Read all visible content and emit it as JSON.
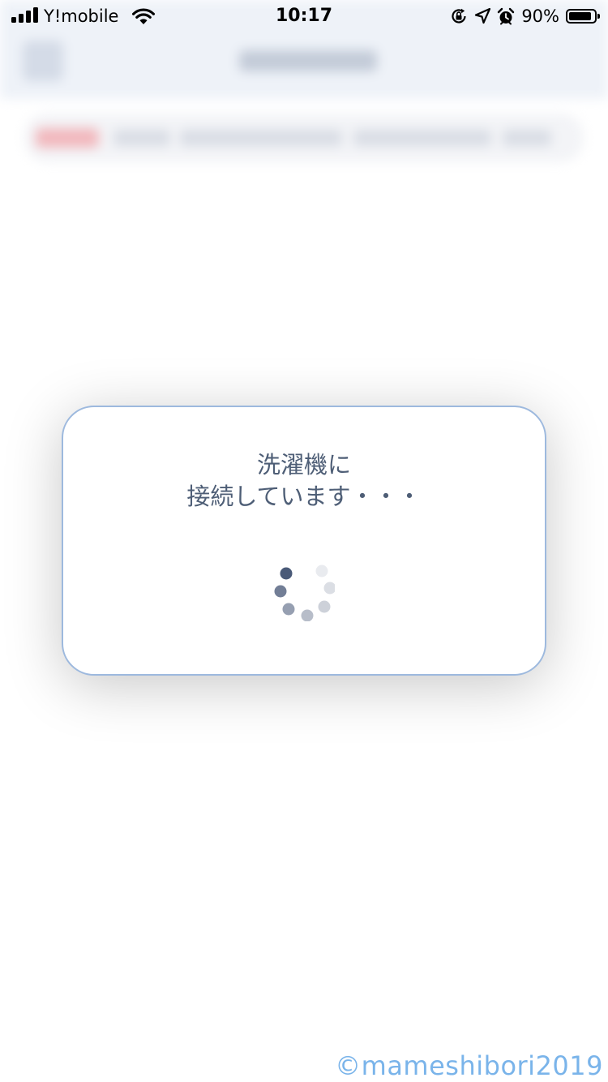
{
  "status_bar": {
    "carrier": "Y!mobile",
    "time": "10:17",
    "battery_percent": "90%",
    "battery_level": 0.9,
    "icons": [
      "cellular-signal-icon",
      "wifi-icon",
      "orientation-lock-icon",
      "location-arrow-icon",
      "alarm-clock-icon",
      "battery-icon"
    ]
  },
  "dialog": {
    "line1": "洗濯機に",
    "line2": "接続しています・・・",
    "text_color": "#4e5e76",
    "border_color": "#9db9de"
  },
  "spinner": {
    "icon": "loading-spinner-icon",
    "dot_color": "#4a5a78"
  },
  "watermark": {
    "text": "©mameshibori2019",
    "color": "#7ab4ea"
  }
}
